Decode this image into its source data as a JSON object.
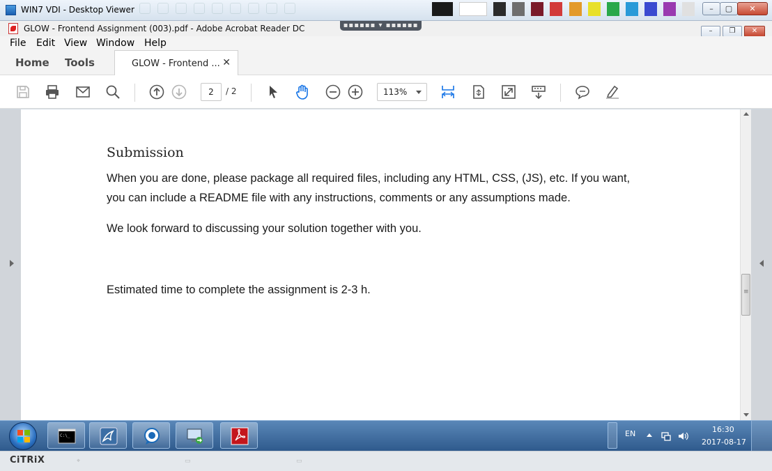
{
  "viewer": {
    "title": "WIN7 VDI - Desktop Viewer"
  },
  "acrobat": {
    "title": "GLOW - Frontend Assignment (003).pdf - Adobe Acrobat Reader DC",
    "menu": [
      "File",
      "Edit",
      "View",
      "Window",
      "Help"
    ],
    "nav": {
      "home": "Home",
      "tools": "Tools"
    },
    "tab": {
      "label": "GLOW - Frontend ...",
      "close": "✕"
    },
    "toolbar": {
      "page_current": "2",
      "page_total": "/ 2",
      "zoom": "113%"
    }
  },
  "document": {
    "heading": "Submission",
    "para1_line1": "When you are done, please package all required files, including any HTML, CSS, (JS), etc. If you want,",
    "para1_line2": "you can include a README file with any instructions, comments or any assumptions made.",
    "para2": "We look forward to discussing your solution together with you.",
    "para3": "Estimated time to complete the assignment is 2-3 h."
  },
  "taskbar": {
    "language": "EN",
    "time": "16:30",
    "date": "2017-08-17"
  },
  "citrix": {
    "logo": "CiTRiX"
  },
  "colors": {
    "accent_blue": "#1473e6",
    "taskbar": "#2f5a8d",
    "close_red": "#c74a33"
  }
}
